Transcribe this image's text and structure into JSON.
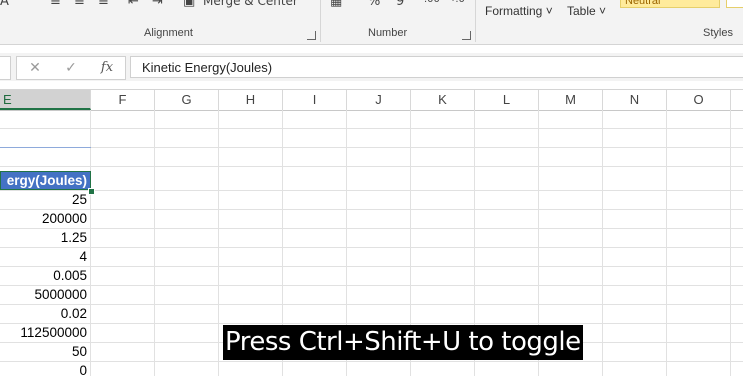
{
  "ribbon": {
    "groups": {
      "alignment": "Alignment",
      "number": "Number",
      "styles": "Styles"
    },
    "buttons": {
      "merge_center": "Merge & Center",
      "formatting": "Formatting",
      "table": "Table",
      "neutral": "Neutral",
      "percent": "%",
      "comma": "9",
      "dec_inc": ".00",
      "dec_dec": "→.0"
    }
  },
  "formula_bar": {
    "fx": "fx",
    "content": "Kinetic Energy(Joules)"
  },
  "columns": [
    "E",
    "F",
    "G",
    "H",
    "I",
    "J",
    "K",
    "L",
    "M",
    "N",
    "O"
  ],
  "column_e": {
    "header_text": "ergy(Joules)",
    "values": [
      "25",
      "200000",
      "1.25",
      "4",
      "0.005",
      "5000000",
      "0.02",
      "112500000",
      "50",
      "0"
    ]
  },
  "toast": "Press Ctrl+Shift+U to toggle",
  "colors": {
    "accent": "#217346",
    "header_fill": "#4472c4"
  }
}
